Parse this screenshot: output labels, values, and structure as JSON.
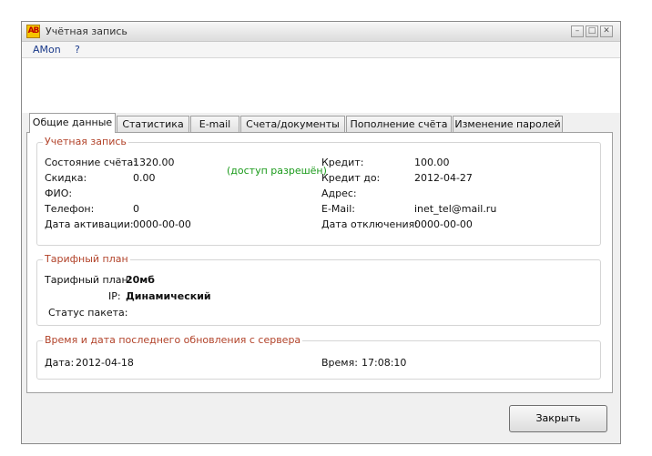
{
  "window": {
    "title": "Учётная запись",
    "app_icon_text": "AB",
    "minimize": "–",
    "maximize": "□",
    "close": "✕"
  },
  "menu": [
    "AMon",
    "?"
  ],
  "tabs": [
    {
      "label": "Общие данные",
      "active": true
    },
    {
      "label": "Статистика"
    },
    {
      "label": "E-mail"
    },
    {
      "label": "Счета/документы"
    },
    {
      "label": "Пополнение счёта"
    },
    {
      "label": "Изменение паролей"
    }
  ],
  "account": {
    "group_title": "Учетная запись",
    "balance_label": "Состояние счёта:",
    "balance_value": "1320.00",
    "discount_label": "Скидка:",
    "discount_value": "0.00",
    "fio_label": "ФИО:",
    "fio_value": "",
    "phone_label": "Телефон:",
    "phone_value": "0",
    "activation_label": "Дата активации:",
    "activation_value": "0000-00-00",
    "access_status": "(доступ разрешён)",
    "credit_label": "Кредит:",
    "credit_value": "100.00",
    "credit_until_label": "Кредит до:",
    "credit_until_value": "2012-04-27",
    "address_label": "Адрес:",
    "address_value": "",
    "email_label": "E-Mail:",
    "email_value": "inet_tel@mail.ru",
    "disconnect_label": "Дата отключения:",
    "disconnect_value": "0000-00-00"
  },
  "tariff": {
    "group_title": "Тарифный план",
    "plan_label": "Тарифный план:",
    "plan_value": "20мб",
    "ip_label": "IP:",
    "ip_value": "Динамический",
    "package_label": "Статус пакета:",
    "package_value": ""
  },
  "update": {
    "group_title": "Время и дата последнего обновления с сервера",
    "date_label": "Дата:",
    "date_value": "2012-04-18",
    "time_label": "Время:",
    "time_value": "17:08:10"
  },
  "buttons": {
    "close_label": "Закрыть"
  }
}
